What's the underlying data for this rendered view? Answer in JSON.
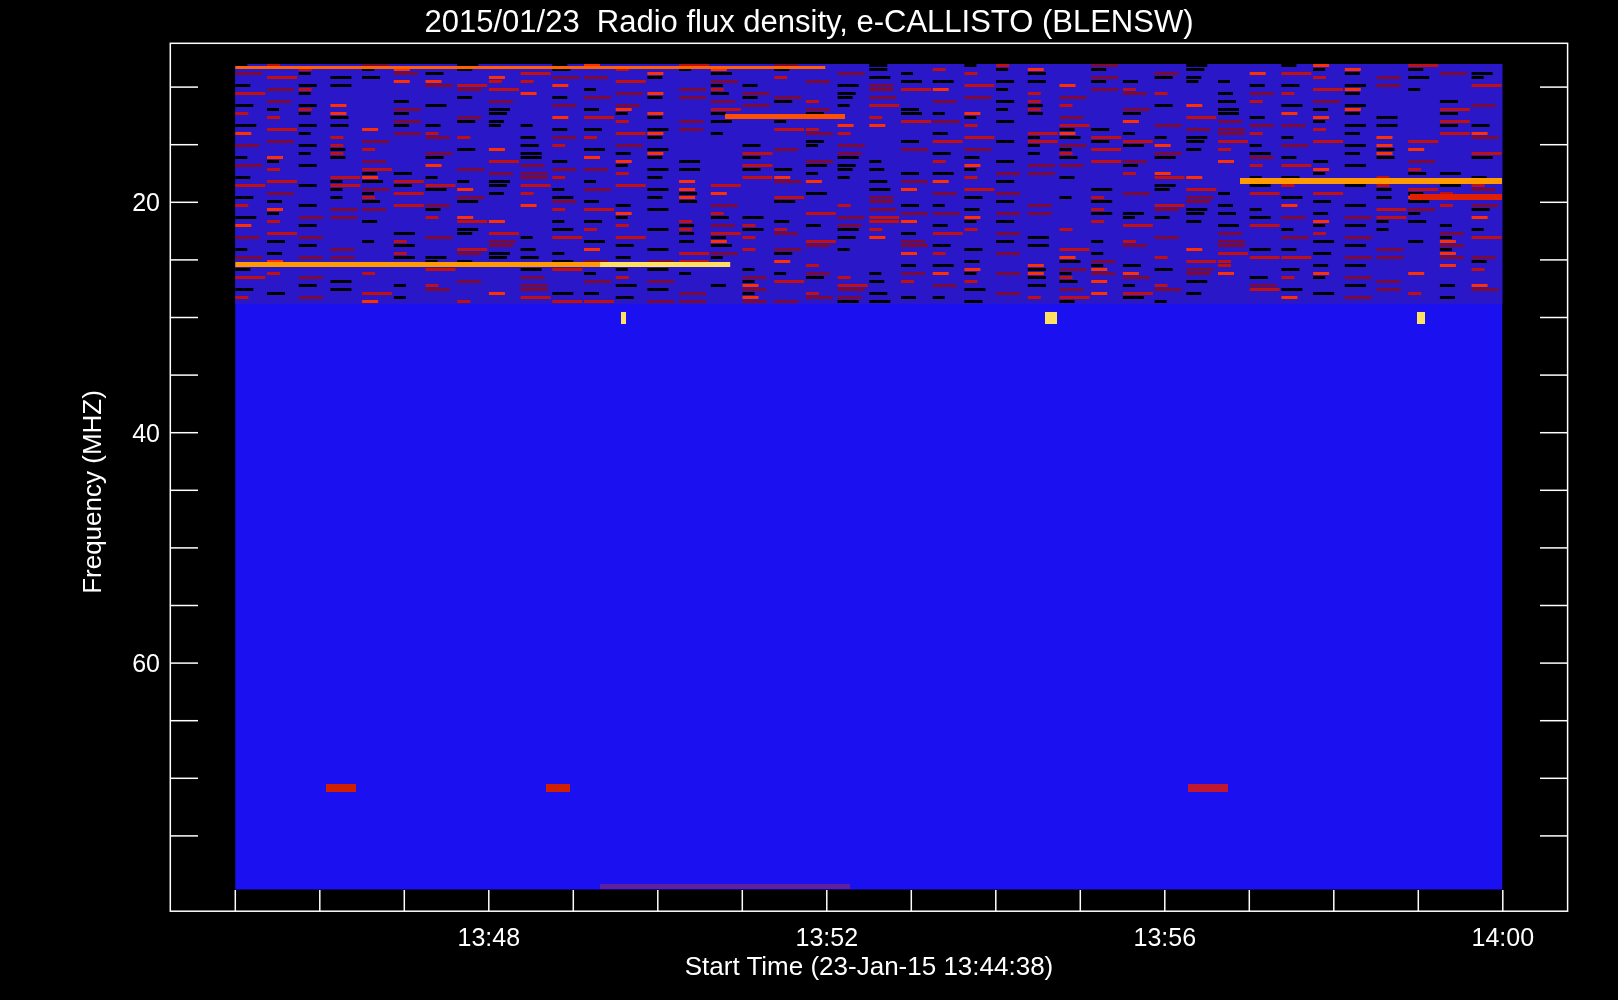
{
  "title": "2015/01/23  Radio flux density, e-CALLISTO (BLENSW)",
  "y_axis": {
    "label": "Frequency (MHZ)",
    "ticks": [
      "20",
      "40",
      "60"
    ]
  },
  "x_axis": {
    "label": "Start Time (23-Jan-15 13:44:38)",
    "ticks": [
      "13:48",
      "13:52",
      "13:56",
      "14:00"
    ]
  }
}
